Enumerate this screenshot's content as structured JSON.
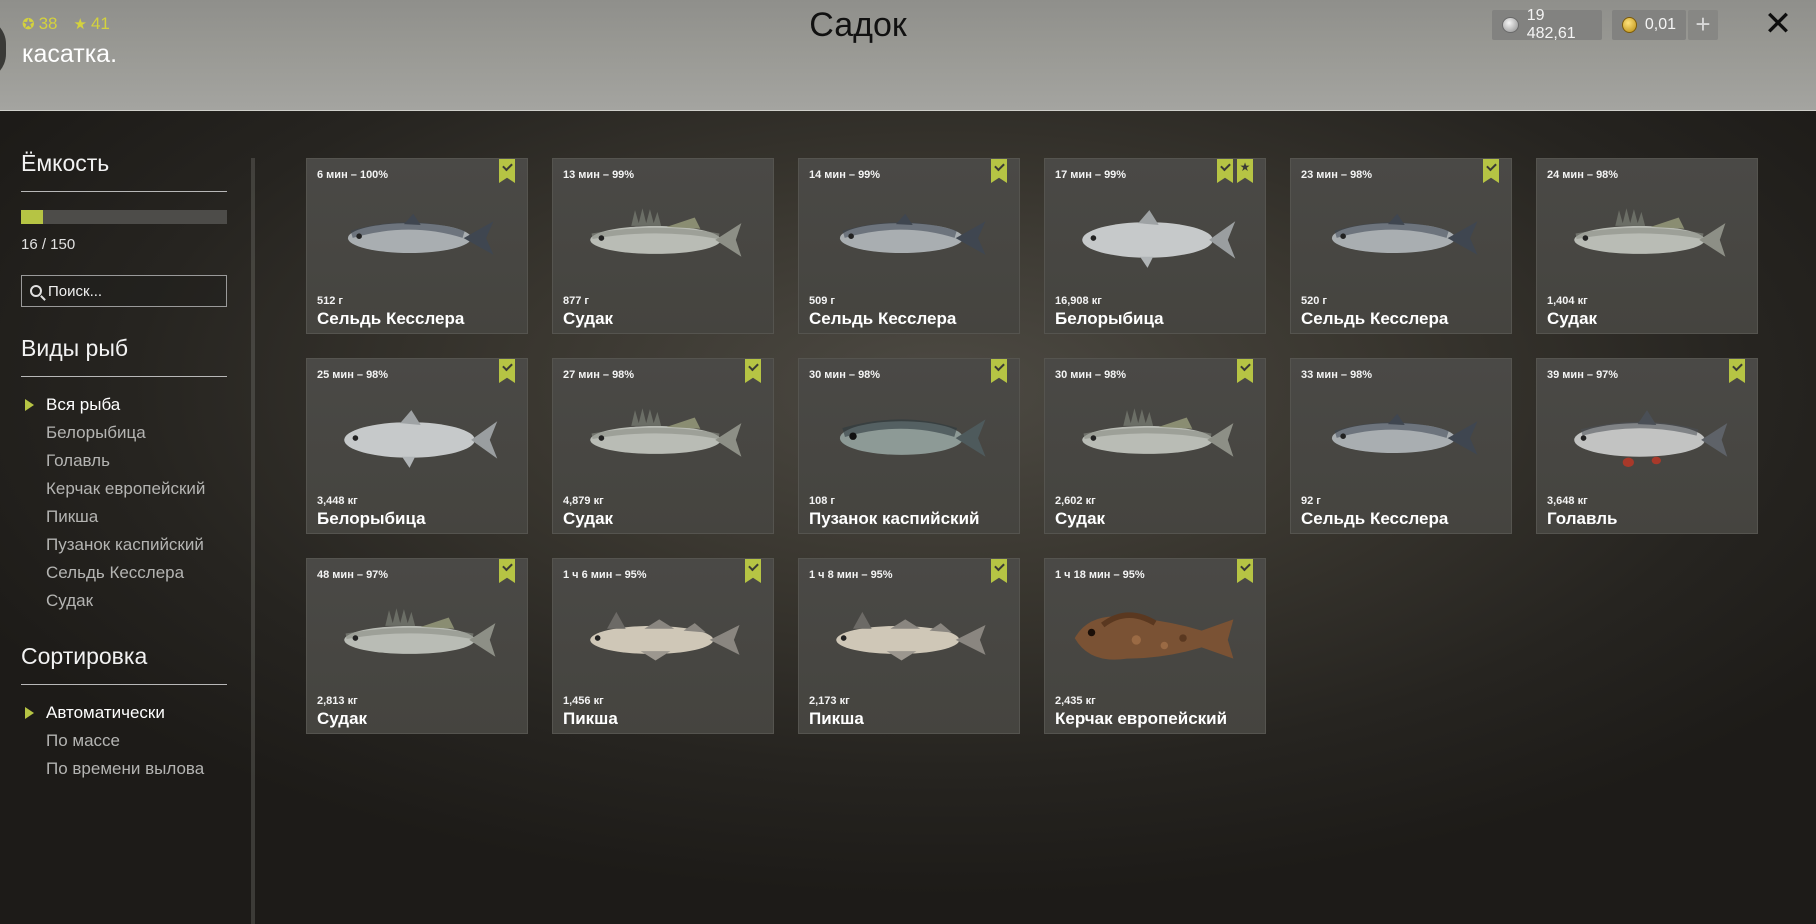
{
  "header": {
    "stats": [
      {
        "icon": "ring-icon",
        "value": "38"
      },
      {
        "icon": "star-icon",
        "value": "41"
      }
    ],
    "player_name": "касатка.",
    "title": "Садок",
    "currency": {
      "silver": "19 482,61",
      "gold": "0,01"
    },
    "plus_label": "+",
    "close_label": "✕"
  },
  "sidebar": {
    "capacity": {
      "heading": "Ёмкость",
      "used": 16,
      "total": 150,
      "label": "16 / 150"
    },
    "search": {
      "placeholder": "Поиск..."
    },
    "species": {
      "heading": "Виды рыб",
      "items": [
        {
          "label": "Вся рыба",
          "active": true
        },
        {
          "label": "Белорыбица",
          "active": false
        },
        {
          "label": "Голавль",
          "active": false
        },
        {
          "label": "Керчак европейский",
          "active": false
        },
        {
          "label": "Пикша",
          "active": false
        },
        {
          "label": "Пузанок каспийский",
          "active": false
        },
        {
          "label": "Сельдь Кесслера",
          "active": false
        },
        {
          "label": "Судак",
          "active": false
        }
      ]
    },
    "sorting": {
      "heading": "Сортировка",
      "items": [
        {
          "label": "Автоматически",
          "active": true
        },
        {
          "label": "По массе",
          "active": false
        },
        {
          "label": "По времени вылова",
          "active": false
        }
      ]
    }
  },
  "colors": {
    "accent": "#b6c444",
    "card_bg": "#4a4946",
    "header_bg": "#999994"
  },
  "fish": [
    {
      "time": "6 мин – 100%",
      "weight": "512 г",
      "name": "Сельдь Кесслера",
      "art": "herring",
      "badges": [
        "check"
      ]
    },
    {
      "time": "13 мин – 99%",
      "weight": "877 г",
      "name": "Судак",
      "art": "zander",
      "badges": []
    },
    {
      "time": "14 мин – 99%",
      "weight": "509 г",
      "name": "Сельдь Кесслера",
      "art": "herring",
      "badges": [
        "check"
      ]
    },
    {
      "time": "17 мин – 99%",
      "weight": "16,908 кг",
      "name": "Белорыбица",
      "art": "whitefish",
      "badges": [
        "check",
        "star"
      ]
    },
    {
      "time": "23 мин – 98%",
      "weight": "520 г",
      "name": "Сельдь Кесслера",
      "art": "herring",
      "badges": [
        "check"
      ]
    },
    {
      "time": "24 мин – 98%",
      "weight": "1,404 кг",
      "name": "Судак",
      "art": "zander",
      "badges": []
    },
    {
      "time": "25 мин – 98%",
      "weight": "3,448 кг",
      "name": "Белорыбица",
      "art": "whitefish",
      "badges": [
        "check"
      ]
    },
    {
      "time": "27 мин – 98%",
      "weight": "4,879 кг",
      "name": "Судак",
      "art": "zander",
      "badges": [
        "check"
      ]
    },
    {
      "time": "30 мин – 98%",
      "weight": "108 г",
      "name": "Пузанок каспийский",
      "art": "shad",
      "badges": [
        "check"
      ]
    },
    {
      "time": "30 мин – 98%",
      "weight": "2,602 кг",
      "name": "Судак",
      "art": "zander",
      "badges": [
        "check"
      ]
    },
    {
      "time": "33 мин – 98%",
      "weight": "92 г",
      "name": "Сельдь Кесслера",
      "art": "herring",
      "badges": []
    },
    {
      "time": "39 мин – 97%",
      "weight": "3,648 кг",
      "name": "Голавль",
      "art": "chub",
      "badges": [
        "check"
      ]
    },
    {
      "time": "48 мин – 97%",
      "weight": "2,813 кг",
      "name": "Судак",
      "art": "zander",
      "badges": [
        "check"
      ]
    },
    {
      "time": "1 ч 6 мин – 95%",
      "weight": "1,456 кг",
      "name": "Пикша",
      "art": "haddock",
      "badges": [
        "check"
      ]
    },
    {
      "time": "1 ч 8 мин – 95%",
      "weight": "2,173 кг",
      "name": "Пикша",
      "art": "haddock",
      "badges": [
        "check"
      ]
    },
    {
      "time": "1 ч 18 мин – 95%",
      "weight": "2,435 кг",
      "name": "Керчак европейский",
      "art": "sculpin",
      "badges": [
        "check"
      ]
    }
  ]
}
